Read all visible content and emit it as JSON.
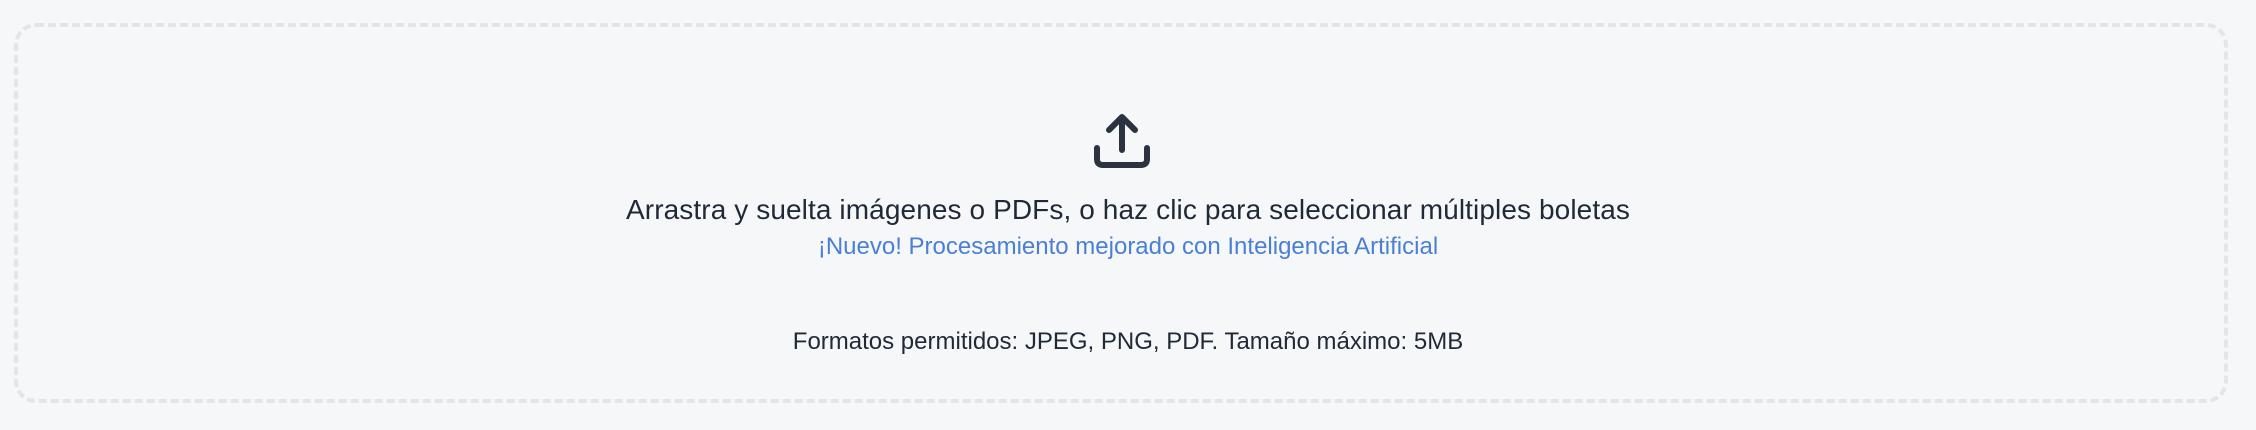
{
  "dropzone": {
    "icon": "upload-icon",
    "instruction": "Arrastra y suelta imágenes o PDFs, o haz clic para seleccionar múltiples boletas",
    "ai_notice": "¡Nuevo! Procesamiento mejorado con Inteligencia Artificial",
    "formats": "Formatos permitidos: JPEG, PNG, PDF. Tamaño máximo: 5MB"
  },
  "colors": {
    "background": "#f6f7f9",
    "text": "#1f2937",
    "accent": "#4a7fd6",
    "border": "#e3e5e9"
  }
}
